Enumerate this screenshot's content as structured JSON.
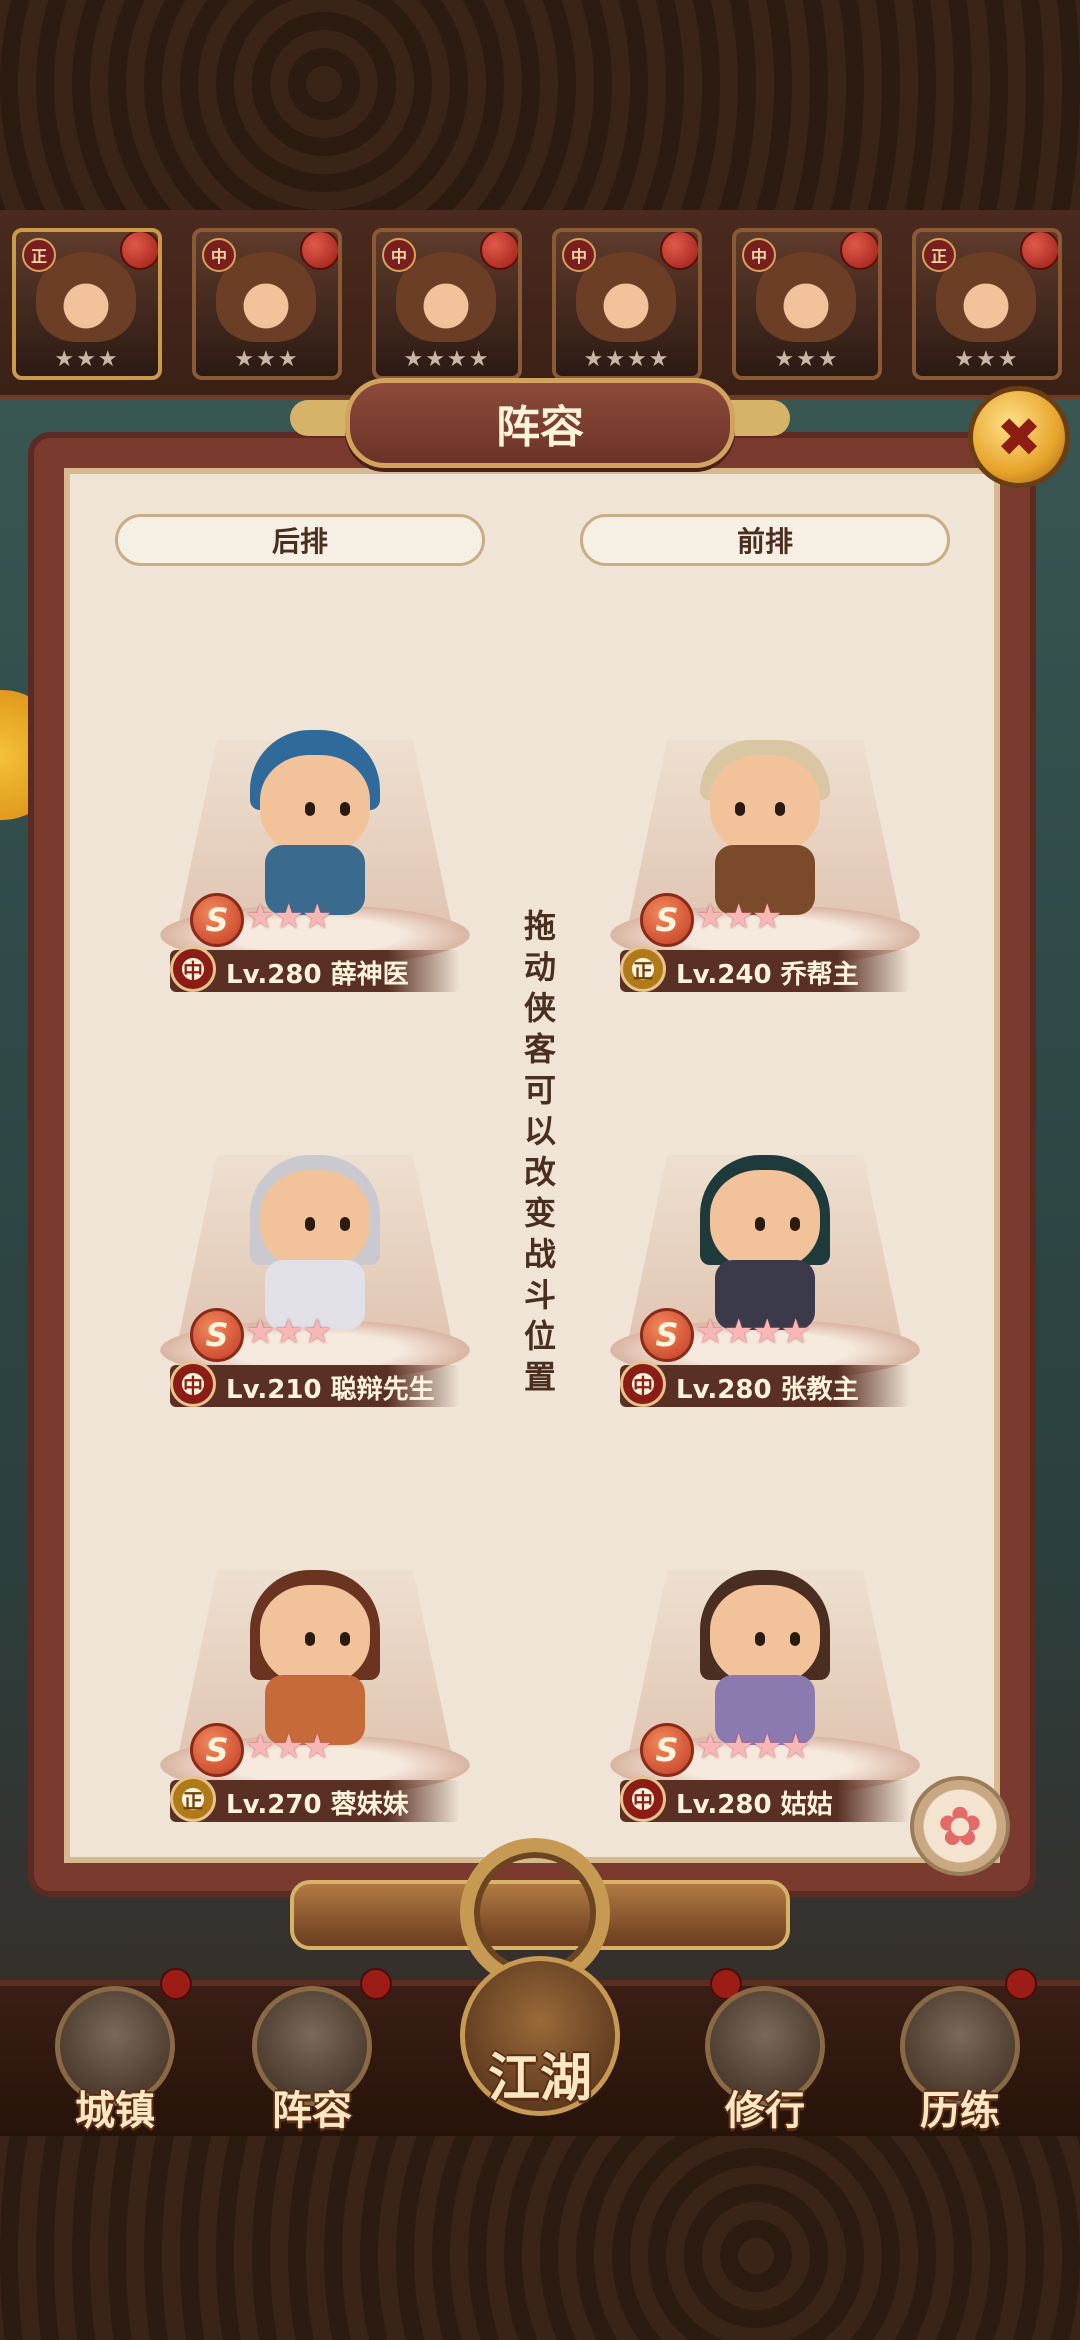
{
  "dialog": {
    "title": "阵容",
    "close_icon": "✖",
    "back_row_label": "后排",
    "front_row_label": "前排",
    "hint": "拖动侠客可以改变战斗位置"
  },
  "roster": [
    {
      "faction": "正",
      "stars": "★★★"
    },
    {
      "faction": "中",
      "stars": "★★★"
    },
    {
      "faction": "中",
      "stars": "★★★★"
    },
    {
      "faction": "中",
      "stars": "★★★★"
    },
    {
      "faction": "中",
      "stars": "★★★"
    },
    {
      "faction": "正",
      "stars": "★★★"
    }
  ],
  "back_row": [
    {
      "rank": "S",
      "stars": "★★★",
      "faction": "中",
      "label": "Lv.280 薛神医"
    },
    {
      "rank": "S",
      "stars": "★★★",
      "faction": "中",
      "label": "Lv.210 聪辩先生"
    },
    {
      "rank": "S",
      "stars": "★★★",
      "faction": "正",
      "label": "Lv.270 蓉妹妹"
    }
  ],
  "front_row": [
    {
      "rank": "S",
      "stars": "★★★",
      "faction": "正",
      "label": "Lv.240 乔帮主"
    },
    {
      "rank": "S",
      "stars": "★★★★",
      "faction": "中",
      "label": "Lv.280 张教主"
    },
    {
      "rank": "S",
      "stars": "★★★★",
      "faction": "中",
      "label": "Lv.280 姑姑"
    }
  ],
  "nav": {
    "town": "城镇",
    "lineup": "阵容",
    "jianghu": "江湖",
    "cultivate": "修行",
    "training": "历练"
  },
  "colors": {
    "dialog_frame": "#7a3a2e",
    "dialog_bg": "#efe4d6",
    "accent_gold": "#d1a35e",
    "faction_zhong": "#8b1d16",
    "faction_zheng": "#b07a1a"
  }
}
